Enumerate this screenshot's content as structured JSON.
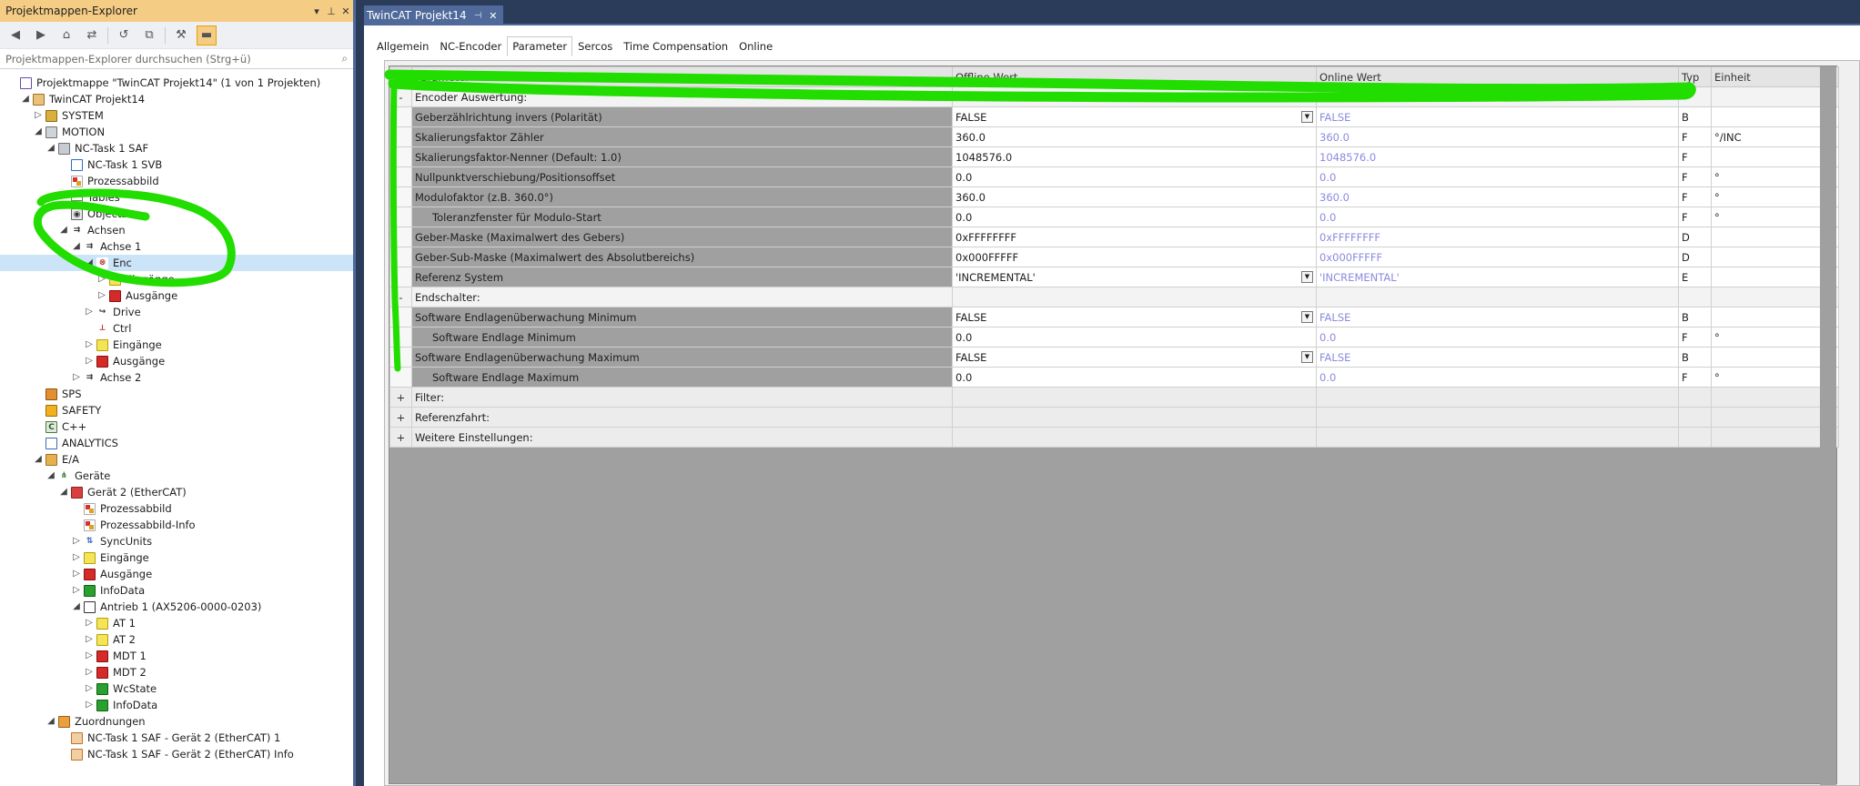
{
  "solution_explorer": {
    "title": "Projektmappen-Explorer",
    "search_placeholder": "Projektmappen-Explorer durchsuchen (Strg+ü)",
    "tree": [
      {
        "id": "solution",
        "label": "Projektmappe \"TwinCAT Projekt14\" (1 von 1 Projekten)",
        "depth": 0,
        "icon": "solution",
        "exp": ""
      },
      {
        "id": "project",
        "label": "TwinCAT Projekt14",
        "depth": 1,
        "icon": "project",
        "exp": "open"
      },
      {
        "id": "system",
        "label": "SYSTEM",
        "depth": 2,
        "icon": "system",
        "exp": "closed"
      },
      {
        "id": "motion",
        "label": "MOTION",
        "depth": 2,
        "icon": "motion",
        "exp": "open"
      },
      {
        "id": "nc-task",
        "label": "NC-Task 1 SAF",
        "depth": 3,
        "icon": "task",
        "exp": "open"
      },
      {
        "id": "nc-svb",
        "label": "NC-Task 1 SVB",
        "depth": 4,
        "icon": "svb",
        "exp": ""
      },
      {
        "id": "prozessabbild",
        "label": "Prozessabbild",
        "depth": 4,
        "icon": "image",
        "exp": ""
      },
      {
        "id": "tables",
        "label": "Tables",
        "depth": 4,
        "icon": "table",
        "exp": ""
      },
      {
        "id": "objects",
        "label": "Objects",
        "depth": 4,
        "icon": "objects",
        "exp": ""
      },
      {
        "id": "achsen",
        "label": "Achsen",
        "depth": 4,
        "icon": "axes",
        "exp": "open"
      },
      {
        "id": "achse1",
        "label": "Achse 1",
        "depth": 5,
        "icon": "axis",
        "exp": "open"
      },
      {
        "id": "enc",
        "label": "Enc",
        "depth": 6,
        "icon": "enc",
        "exp": "open",
        "selected": true
      },
      {
        "id": "enc-in",
        "label": "Eingänge",
        "depth": 7,
        "icon": "in",
        "exp": "closed"
      },
      {
        "id": "enc-out",
        "label": "Ausgänge",
        "depth": 7,
        "icon": "out",
        "exp": "closed"
      },
      {
        "id": "drive",
        "label": "Drive",
        "depth": 6,
        "icon": "drive",
        "exp": "closed"
      },
      {
        "id": "ctrl",
        "label": "Ctrl",
        "depth": 6,
        "icon": "ctrl",
        "exp": ""
      },
      {
        "id": "ax-in",
        "label": "Eingänge",
        "depth": 6,
        "icon": "in",
        "exp": "closed"
      },
      {
        "id": "ax-out",
        "label": "Ausgänge",
        "depth": 6,
        "icon": "out",
        "exp": "closed"
      },
      {
        "id": "achse2",
        "label": "Achse 2",
        "depth": 5,
        "icon": "axis",
        "exp": "closed"
      },
      {
        "id": "sps",
        "label": "SPS",
        "depth": 2,
        "icon": "sps",
        "exp": ""
      },
      {
        "id": "safety",
        "label": "SAFETY",
        "depth": 2,
        "icon": "safety",
        "exp": ""
      },
      {
        "id": "cpp",
        "label": "C++",
        "depth": 2,
        "icon": "cpp",
        "exp": ""
      },
      {
        "id": "analytics",
        "label": "ANALYTICS",
        "depth": 2,
        "icon": "analytics",
        "exp": ""
      },
      {
        "id": "ea",
        "label": "E/A",
        "depth": 2,
        "icon": "ea",
        "exp": "open"
      },
      {
        "id": "geraete",
        "label": "Geräte",
        "depth": 3,
        "icon": "devices",
        "exp": "open"
      },
      {
        "id": "geraet2",
        "label": "Gerät 2 (EtherCAT)",
        "depth": 4,
        "icon": "ethercat",
        "exp": "open"
      },
      {
        "id": "g-pa",
        "label": "Prozessabbild",
        "depth": 5,
        "icon": "image",
        "exp": ""
      },
      {
        "id": "g-pai",
        "label": "Prozessabbild-Info",
        "depth": 5,
        "icon": "image",
        "exp": ""
      },
      {
        "id": "sync",
        "label": "SyncUnits",
        "depth": 5,
        "icon": "sync",
        "exp": "closed"
      },
      {
        "id": "g-in",
        "label": "Eingänge",
        "depth": 5,
        "icon": "in",
        "exp": "closed"
      },
      {
        "id": "g-out",
        "label": "Ausgänge",
        "depth": 5,
        "icon": "out",
        "exp": "closed"
      },
      {
        "id": "g-info",
        "label": "InfoData",
        "depth": 5,
        "icon": "info",
        "exp": "closed"
      },
      {
        "id": "antrieb1",
        "label": "Antrieb 1 (AX5206-0000-0203)",
        "depth": 5,
        "icon": "drive2",
        "exp": "open"
      },
      {
        "id": "at1",
        "label": "AT 1",
        "depth": 6,
        "icon": "in",
        "exp": "closed"
      },
      {
        "id": "at2",
        "label": "AT 2",
        "depth": 6,
        "icon": "in",
        "exp": "closed"
      },
      {
        "id": "mdt1",
        "label": "MDT 1",
        "depth": 6,
        "icon": "out",
        "exp": "closed"
      },
      {
        "id": "mdt2",
        "label": "MDT 2",
        "depth": 6,
        "icon": "out",
        "exp": "closed"
      },
      {
        "id": "wcstate",
        "label": "WcState",
        "depth": 6,
        "icon": "info",
        "exp": "closed"
      },
      {
        "id": "a-info",
        "label": "InfoData",
        "depth": 6,
        "icon": "info",
        "exp": "closed"
      },
      {
        "id": "zuordnungen",
        "label": "Zuordnungen",
        "depth": 3,
        "icon": "map",
        "exp": "open"
      },
      {
        "id": "map1",
        "label": "NC-Task 1 SAF - Gerät 2 (EtherCAT) 1",
        "depth": 4,
        "icon": "mapitem",
        "exp": ""
      },
      {
        "id": "map2",
        "label": "NC-Task 1 SAF - Gerät 2 (EtherCAT) Info",
        "depth": 4,
        "icon": "mapitem",
        "exp": ""
      }
    ]
  },
  "document": {
    "tab_title": "TwinCAT Projekt14",
    "sub_tabs": [
      "Allgemein",
      "NC-Encoder",
      "Parameter",
      "Sercos",
      "Time Compensation",
      "Online"
    ],
    "active_sub_tab": "Parameter",
    "grid": {
      "headers": {
        "ctl": "",
        "param": "Parameter",
        "offline": "Offline Wert",
        "online": "Online Wert",
        "typ": "Typ",
        "unit": "Einheit"
      },
      "rows": [
        {
          "kind": "cat",
          "ctl": "-",
          "name": "Encoder Auswertung:"
        },
        {
          "kind": "p",
          "name": "Geberzählrichtung invers (Polarität)",
          "off": "FALSE",
          "dd": true,
          "on": "FALSE",
          "typ": "B",
          "unit": ""
        },
        {
          "kind": "p",
          "name": "Skalierungsfaktor Zähler",
          "off": "360.0",
          "on": "360.0",
          "typ": "F",
          "unit": "°/INC"
        },
        {
          "kind": "p",
          "name": "Skalierungsfaktor-Nenner (Default: 1.0)",
          "off": "1048576.0",
          "on": "1048576.0",
          "typ": "F",
          "unit": ""
        },
        {
          "kind": "p",
          "name": "Nullpunktverschiebung/Positionsoffset",
          "off": "0.0",
          "on": "0.0",
          "typ": "F",
          "unit": "°"
        },
        {
          "kind": "p",
          "name": "Modulofaktor (z.B. 360.0°)",
          "off": "360.0",
          "on": "360.0",
          "typ": "F",
          "unit": "°"
        },
        {
          "kind": "p",
          "ind": true,
          "name": "Toleranzfenster für Modulo-Start",
          "off": "0.0",
          "on": "0.0",
          "typ": "F",
          "unit": "°"
        },
        {
          "kind": "p",
          "name": "Geber-Maske (Maximalwert des Gebers)",
          "off": "0xFFFFFFFF",
          "on": "0xFFFFFFFF",
          "typ": "D",
          "unit": ""
        },
        {
          "kind": "p",
          "name": "Geber-Sub-Maske (Maximalwert des Absolutbereichs)",
          "off": "0x000FFFFF",
          "on": "0x000FFFFF",
          "typ": "D",
          "unit": ""
        },
        {
          "kind": "p",
          "name": "Referenz System",
          "off": "'INCREMENTAL'",
          "dd": true,
          "on": "'INCREMENTAL'",
          "typ": "E",
          "unit": ""
        },
        {
          "kind": "cat",
          "ctl": "-",
          "name": "Endschalter:"
        },
        {
          "kind": "p",
          "name": "Software Endlagenüberwachung Minimum",
          "off": "FALSE",
          "dd": true,
          "on": "FALSE",
          "typ": "B",
          "unit": ""
        },
        {
          "kind": "p",
          "ind": true,
          "name": "Software Endlage Minimum",
          "off": "0.0",
          "on": "0.0",
          "typ": "F",
          "unit": "°"
        },
        {
          "kind": "p",
          "name": "Software Endlagenüberwachung Maximum",
          "off": "FALSE",
          "dd": true,
          "on": "FALSE",
          "typ": "B",
          "unit": ""
        },
        {
          "kind": "p",
          "ind": true,
          "name": "Software Endlage Maximum",
          "off": "0.0",
          "on": "0.0",
          "typ": "F",
          "unit": "°"
        },
        {
          "kind": "cat2",
          "ctl": "+",
          "name": "Filter:"
        },
        {
          "kind": "cat2",
          "ctl": "+",
          "name": "Referenzfahrt:"
        },
        {
          "kind": "cat2",
          "ctl": "+",
          "name": "Weitere Einstellungen:"
        }
      ]
    }
  },
  "colors": {
    "annotation": "#22dd00",
    "online_value": "#8a8ae0",
    "selected_row": "#cce4f7",
    "tab_active": "#4f6a9a"
  }
}
